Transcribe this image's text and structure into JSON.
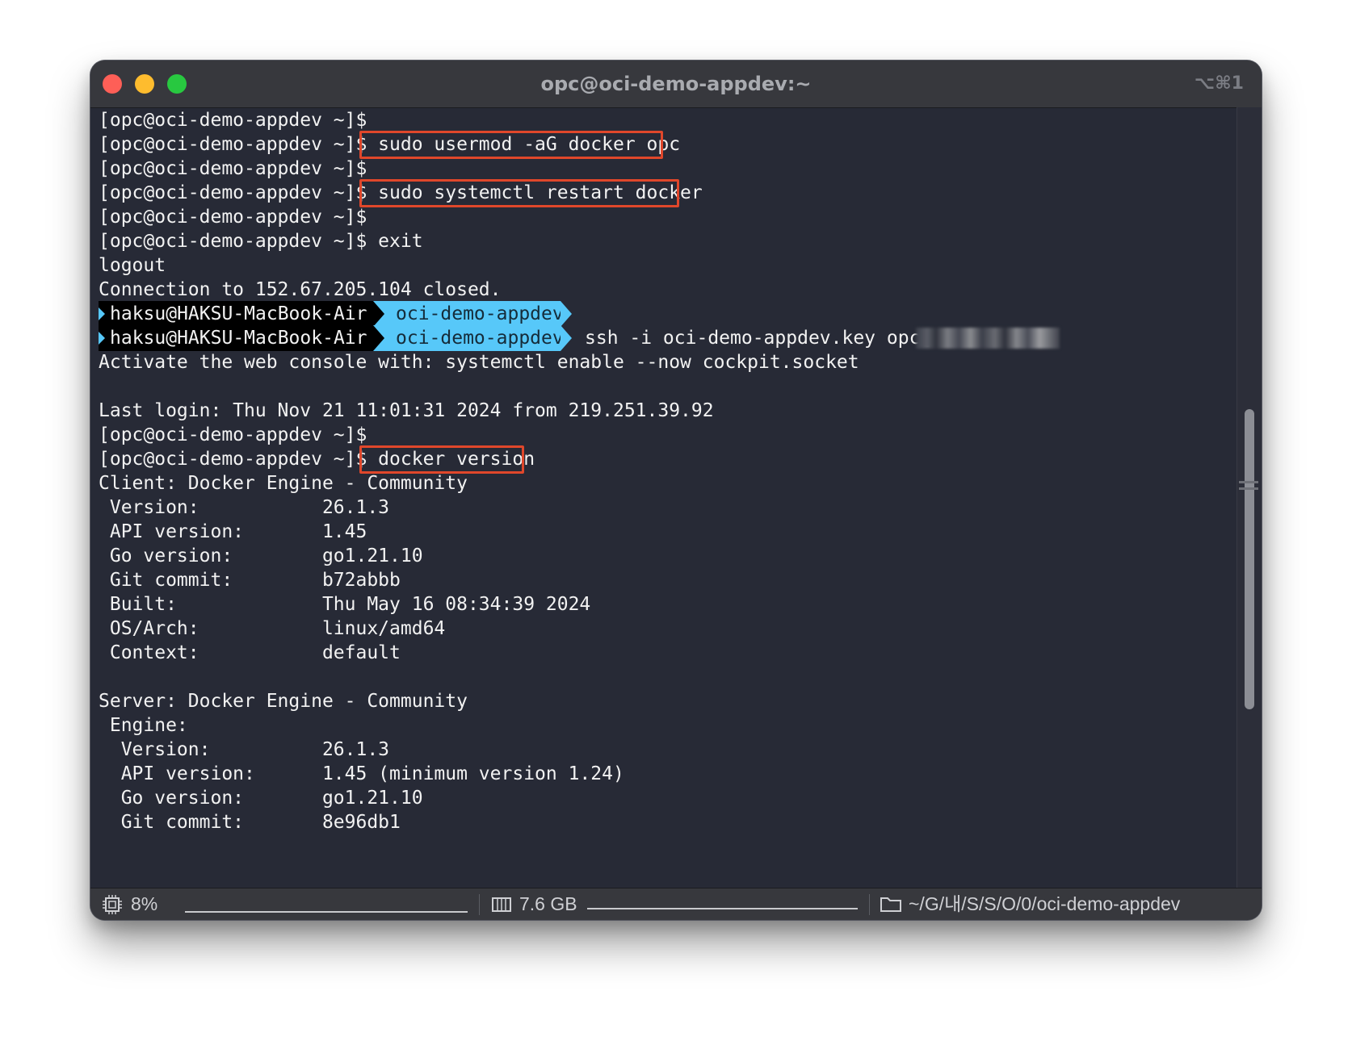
{
  "window": {
    "title": "opc@oci-demo-appdev:~",
    "shortcut": "⌥⌘1"
  },
  "terminal": {
    "lines": [
      "[opc@oci-demo-appdev ~]$",
      "[opc@oci-demo-appdev ~]$ sudo usermod -aG docker opc",
      "[opc@oci-demo-appdev ~]$",
      "[opc@oci-demo-appdev ~]$ sudo systemctl restart docker",
      "[opc@oci-demo-appdev ~]$",
      "[opc@oci-demo-appdev ~]$ exit",
      "logout",
      "Connection to 152.67.205.104 closed.",
      "",
      "",
      "Activate the web console with: systemctl enable --now cockpit.socket",
      "",
      "Last login: Thu Nov 21 11:01:31 2024 from 219.251.39.92",
      "[opc@oci-demo-appdev ~]$",
      "[opc@oci-demo-appdev ~]$ docker version",
      "Client: Docker Engine - Community",
      " Version:           26.1.3",
      " API version:       1.45",
      " Go version:        go1.21.10",
      " Git commit:        b72abbb",
      " Built:             Thu May 16 08:34:39 2024",
      " OS/Arch:           linux/amd64",
      " Context:           default",
      "",
      "Server: Docker Engine - Community",
      " Engine:",
      "  Version:          26.1.3",
      "  API version:      1.45 (minimum version 1.24)",
      "  Go version:       go1.21.10",
      "  Git commit:       8e96db1"
    ],
    "prompt_host": "haksu@HAKSU-MacBook-Air",
    "prompt_dir": "oci-demo-appdev",
    "ssh_command": "ssh -i oci-demo-appdev.key opc@",
    "highlighted_commands": [
      "sudo usermod -aG docker opc",
      "sudo systemctl restart docker",
      "docker version"
    ]
  },
  "statusbar": {
    "cpu": "8%",
    "memory": "7.6 GB",
    "path": "~/G/내/S/S/O/0/oci-demo-appdev"
  },
  "colors": {
    "background": "#272a36",
    "foreground": "#f2f2f2",
    "highlight_border": "#e0472b",
    "prompt_dir_bg": "#57c8f9",
    "prompt_host_bg": "#000000",
    "titlebar": "#37383d"
  }
}
